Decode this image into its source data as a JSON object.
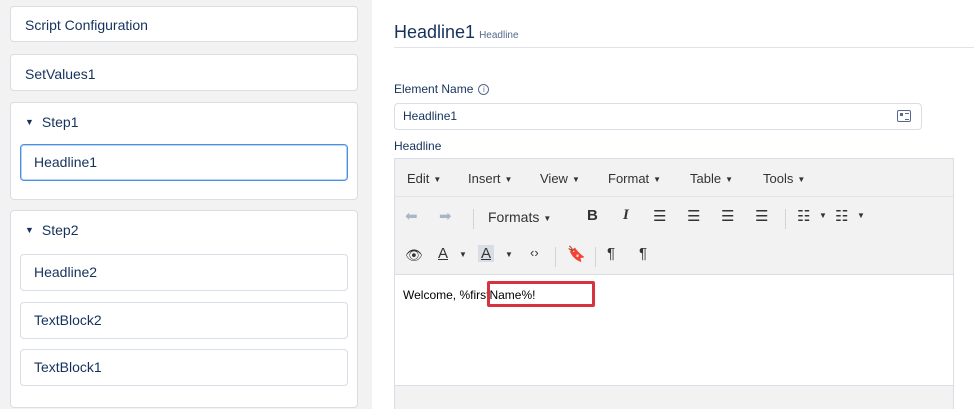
{
  "left_panel": {
    "script_configuration": "Script Configuration",
    "set_values": "SetValues1",
    "step1": {
      "label": "Step1",
      "items": [
        "Headline1"
      ]
    },
    "step2": {
      "label": "Step2",
      "items": [
        "Headline2",
        "TextBlock2",
        "TextBlock1"
      ]
    }
  },
  "detail": {
    "title": "Headline1",
    "subtitle": "Headline",
    "element_name_label": "Element Name",
    "element_name_value": "Headline1",
    "headline_label": "Headline"
  },
  "editor": {
    "menus": [
      "Edit",
      "Insert",
      "View",
      "Format",
      "Table",
      "Tools"
    ],
    "formats_label": "Formats",
    "content_prefix": "Welcome, ",
    "content_merge_field": "%firstName%!"
  },
  "colors": {
    "highlight": "#d63341",
    "selected_border": "#4a90e2",
    "panel_bg": "#f3f2f2"
  }
}
